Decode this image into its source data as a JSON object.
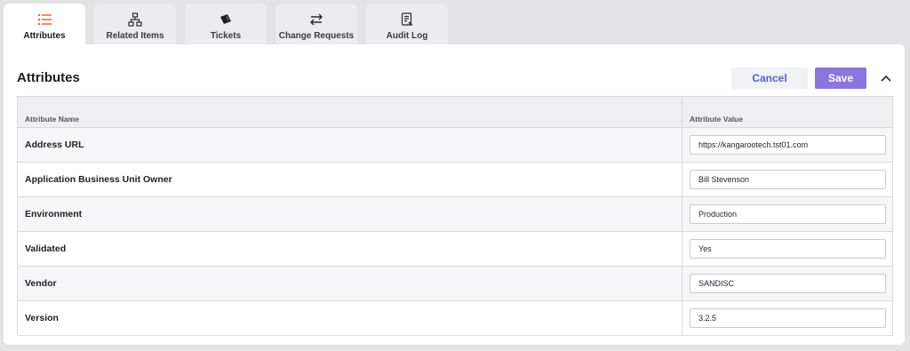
{
  "tabs": [
    {
      "label": "Attributes",
      "icon": "list-icon",
      "active": true
    },
    {
      "label": "Related Items",
      "icon": "hierarchy-icon",
      "active": false
    },
    {
      "label": "Tickets",
      "icon": "ticket-icon",
      "active": false
    },
    {
      "label": "Change Requests",
      "icon": "swap-arrows-icon",
      "active": false
    },
    {
      "label": "Audit Log",
      "icon": "document-icon",
      "active": false
    }
  ],
  "colors": {
    "accent": "#f26b3a",
    "save_bg": "#8a76dd",
    "cancel_text": "#5b61c6"
  },
  "section": {
    "title": "Attributes",
    "cancel_label": "Cancel",
    "save_label": "Save",
    "collapse_icon": "chevron-up-icon"
  },
  "table": {
    "headers": {
      "name": "Attribute Name",
      "value": "Attribute Value"
    },
    "rows": [
      {
        "name": "Address URL",
        "value": "https://kangarootech.tst01.com"
      },
      {
        "name": "Application Business Unit Owner",
        "value": "Bill Stevenson"
      },
      {
        "name": "Environment",
        "value": "Production"
      },
      {
        "name": "Validated",
        "value": "Yes"
      },
      {
        "name": "Vendor",
        "value": "SANDISC"
      },
      {
        "name": "Version",
        "value": "3.2.5"
      }
    ]
  }
}
